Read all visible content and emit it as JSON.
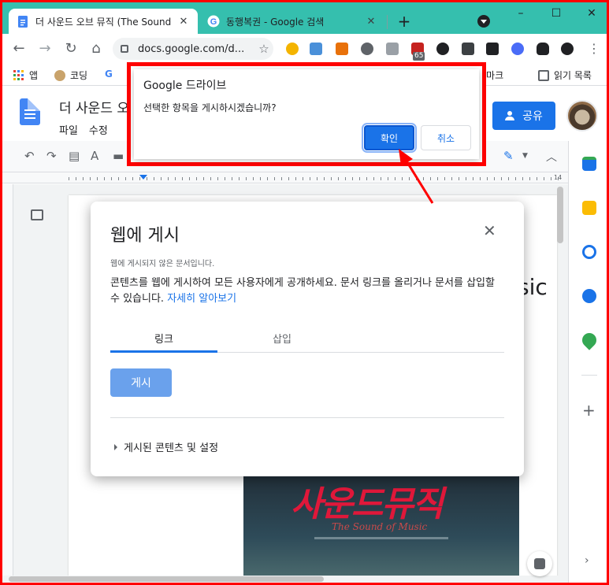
{
  "browser": {
    "tabs": [
      {
        "label": "더 사운드 오브 뮤직 (The Sound",
        "active": true
      },
      {
        "label": "동행복권 - Google 검색",
        "active": false
      }
    ],
    "new_tab": "+",
    "window_controls": {
      "minimize": "–",
      "maximize": "☐",
      "close": "✕"
    },
    "address": "docs.google.com/d...",
    "extension_badge": "65",
    "bookmarks": [
      {
        "label": "앱"
      },
      {
        "label": "코딩"
      },
      {
        "label": "북마크"
      },
      {
        "label": "읽기 목록"
      }
    ]
  },
  "docs": {
    "doc_title": "더 사운드 오",
    "menu": [
      "파일",
      "수정"
    ],
    "share_label": "공유",
    "background_text": "sic",
    "poster": {
      "title": "사운드뮤직",
      "subtitle": "The Sound of Music"
    }
  },
  "publish_dialog": {
    "title": "웹에 게시",
    "note": "웹에 게시되지 않은 문서입니다.",
    "description": "콘텐츠를 웹에 게시하여 모든 사용자에게 공개하세요. 문서 링크를 올리거나 문서를 삽입할 수 있습니다.",
    "learn_more": "자세히 알아보기",
    "tabs": [
      "링크",
      "삽입"
    ],
    "publish_button": "게시",
    "settings_label": "게시된 콘텐츠 및 설정"
  },
  "confirm_dialog": {
    "title": "Google 드라이브",
    "message": "선택한 항목을 게시하시겠습니까?",
    "ok_label": "확인",
    "cancel_label": "취소"
  },
  "colors": {
    "tab_strip": "#35bfae",
    "accent": "#1a73e8",
    "highlight": "#ff0000"
  }
}
